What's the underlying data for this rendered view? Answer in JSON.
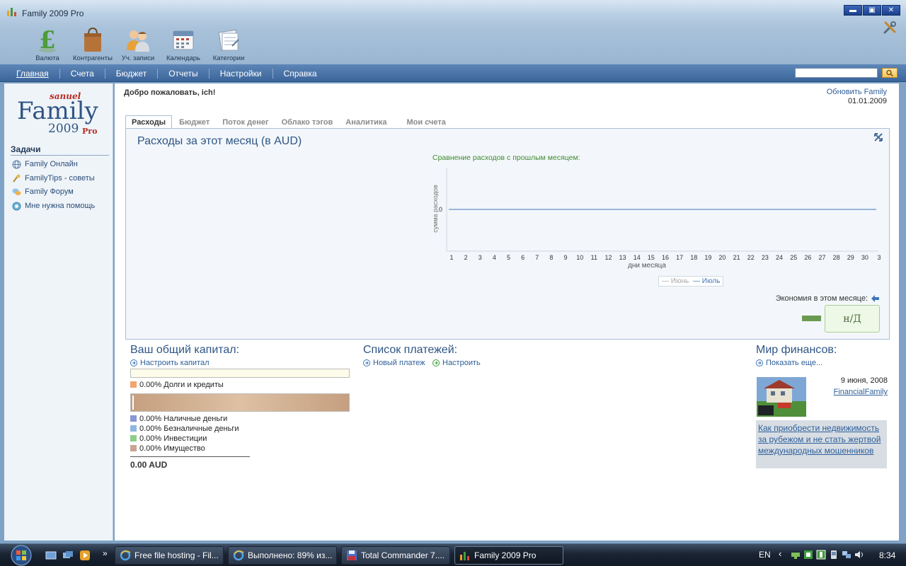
{
  "window": {
    "title": "Family 2009 Pro",
    "minimize": "▬",
    "maximize": "▣",
    "close": "✕"
  },
  "toolbar": {
    "items": [
      {
        "label": "Валюта",
        "icon": "currency-icon"
      },
      {
        "label": "Контрагенты",
        "icon": "shopping-bag-icon"
      },
      {
        "label": "Уч. записи",
        "icon": "users-icon"
      },
      {
        "label": "Календарь",
        "icon": "calendar-icon"
      },
      {
        "label": "Категории",
        "icon": "categories-icon"
      }
    ]
  },
  "menu": {
    "items": [
      "Главная",
      "Счета",
      "Бюджет",
      "Отчеты",
      "Настройки",
      "Справка"
    ],
    "active": "Главная"
  },
  "search": {
    "value": "",
    "placeholder": ""
  },
  "sidebar": {
    "logo": {
      "brand": "sanuel",
      "name": "Family",
      "year": "2009",
      "edition": "Pro"
    },
    "tasks_title": "Задачи",
    "tasks": [
      "Family Онлайн",
      "FamilyTips - советы",
      "Family Форум",
      "Мне нужна помощь"
    ]
  },
  "main": {
    "welcome": "Добро пожаловать, ich!",
    "refresh_link": "Обновить Family",
    "date": "01.01.2009",
    "tabs": [
      "Расходы",
      "Бюджет",
      "Поток денег",
      "Облако тэгов",
      "Аналитика",
      "Мои счета"
    ],
    "active_tab": "Расходы",
    "panel": {
      "title": "Расходы за этот месяц (в AUD)",
      "chart_title": "Сравнение расходов с прошлым месяцем:",
      "savings_label": "Экономия в этом месяце:",
      "savings_value": "н/Д"
    },
    "capital": {
      "title": "Ваш общий капитал:",
      "setup_link": "Настроить капитал",
      "debts": "0.00% Долги и кредиты",
      "assets": [
        {
          "label": "0.00% Наличные деньги",
          "color": "#8a96d6"
        },
        {
          "label": "0.00% Безналичные деньги",
          "color": "#8fb7e0"
        },
        {
          "label": "0.00% Инвестиции",
          "color": "#8fce86"
        },
        {
          "label": "0.00% Имущество",
          "color": "#c9a592"
        }
      ],
      "debts_color": "#f2a56c",
      "total": "0.00 AUD"
    },
    "payments": {
      "title": "Список платежей:",
      "new_link": "Новый платеж",
      "setup_link": "Настроить"
    },
    "finance": {
      "title": "Мир финансов:",
      "more_link": "Показать еще...",
      "news_date": "9 июня, 2008",
      "news_source": "FinancialFamily",
      "headline": "Как приобрести недвижимость за рубежом и не стать жертвой международных мошенников"
    }
  },
  "chart_data": {
    "type": "line",
    "title": "Сравнение расходов с прошлым месяцем:",
    "xlabel": "дни месяца",
    "ylabel": "сумма расходов",
    "x_ticks": [
      "1",
      "2",
      "3",
      "4",
      "5",
      "6",
      "7",
      "8",
      "9",
      "10",
      "11",
      "12",
      "13",
      "14",
      "15",
      "16",
      "17",
      "18",
      "19",
      "20",
      "21",
      "22",
      "23",
      "24",
      "25",
      "26",
      "27",
      "28",
      "29",
      "30",
      "3"
    ],
    "y_ticks": [
      "0"
    ],
    "series": [
      {
        "name": "Июнь",
        "values": [],
        "color": "#a8a8a8"
      },
      {
        "name": "Июль",
        "values": [
          0,
          0,
          0,
          0,
          0,
          0,
          0,
          0,
          0,
          0,
          0,
          0,
          0,
          0,
          0,
          0,
          0,
          0,
          0,
          0,
          0,
          0,
          0,
          0,
          0,
          0,
          0,
          0,
          0,
          0,
          0
        ],
        "color": "#3f76b8"
      }
    ],
    "legend": "bottom-center",
    "grid": false
  },
  "taskbar": {
    "buttons": [
      {
        "label": "Free file hosting - Fil...",
        "icon": "ie-icon"
      },
      {
        "label": "Выполнено: 89% из...",
        "icon": "ie-icon"
      },
      {
        "label": "Total Commander 7....",
        "icon": "floppy-icon"
      },
      {
        "label": "Family 2009 Pro",
        "icon": "family-app-icon"
      }
    ],
    "active": "Family 2009 Pro",
    "more": "»",
    "lang": "EN",
    "tray_arrow": "‹",
    "clock": "8:34"
  }
}
